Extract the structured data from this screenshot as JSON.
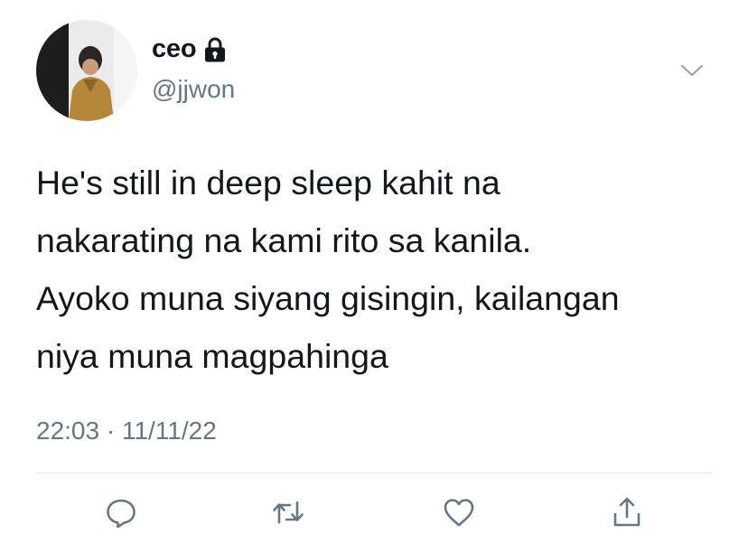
{
  "user": {
    "display_name": "ceo",
    "handle": "@jjwon",
    "protected_icon": "lock-icon",
    "avatar_icon": "avatar"
  },
  "header": {
    "menu_icon": "chevron-down-icon"
  },
  "tweet": {
    "text": "He's still in deep sleep kahit na\nnakarating na kami rito sa kanila.\nAyoko muna siyang gisingin, kailangan\nniya muna magpahinga",
    "timestamp": "22:03 · 11/11/22"
  },
  "actions": [
    {
      "icon": "reply-icon"
    },
    {
      "icon": "retweet-icon"
    },
    {
      "icon": "like-icon"
    },
    {
      "icon": "share-icon"
    }
  ],
  "colors": {
    "text_primary": "#14171a",
    "text_secondary": "#657786",
    "divider": "#e1e8ed",
    "icon": "#657786"
  }
}
